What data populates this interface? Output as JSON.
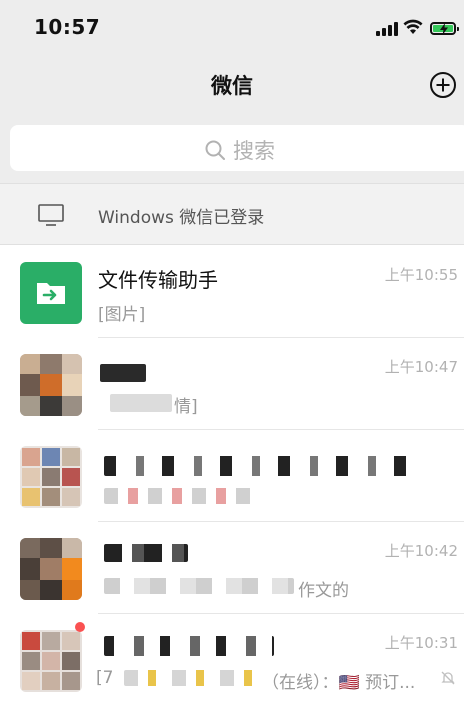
{
  "status_bar": {
    "time": "10:57",
    "icons": [
      "signal-icon",
      "wifi-icon",
      "battery-charging-icon"
    ],
    "battery_color": "#34c759"
  },
  "nav": {
    "title": "微信",
    "add_icon": "plus-circle-icon"
  },
  "search": {
    "placeholder": "搜索",
    "icon": "search-icon"
  },
  "windows_banner": {
    "label": "Windows 微信已登录",
    "icon": "monitor-icon"
  },
  "chats": [
    {
      "name": "文件传输助手",
      "preview": "[图片]",
      "time": "上午10:55",
      "avatar": "file-transfer-icon",
      "avatar_color": "#2aae67"
    },
    {
      "name": "",
      "preview": "情]",
      "time": "上午10:47",
      "avatar": "blurred-avatar"
    },
    {
      "name": "",
      "preview": "",
      "time": "",
      "avatar": "blurred-group-avatar"
    },
    {
      "name": "",
      "preview": "作文的",
      "time": "上午10:42",
      "avatar": "blurred-avatar"
    },
    {
      "name": "",
      "preview_prefix": "[7",
      "preview": "（在线）：🇺🇸 预订...",
      "time": "上午10:31",
      "avatar": "blurred-group-avatar",
      "muted_icon": "bell-muted-icon"
    }
  ],
  "colors": {
    "header_bg": "#ededed",
    "banner_bg": "#f2f2f2",
    "unread": "#fa5151"
  }
}
